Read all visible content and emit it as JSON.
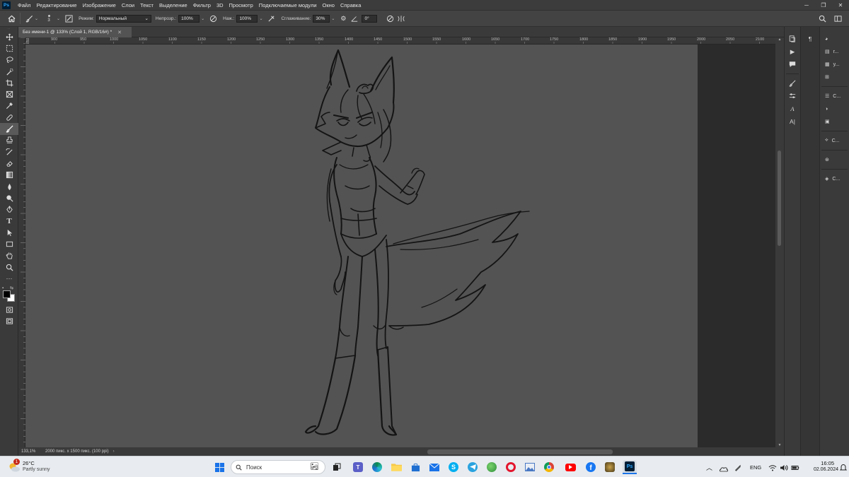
{
  "app": {
    "logo": "Ps",
    "menu": [
      "Файл",
      "Редактирование",
      "Изображение",
      "Слои",
      "Текст",
      "Выделение",
      "Фильтр",
      "3D",
      "Просмотр",
      "Подключаемые модули",
      "Окно",
      "Справка"
    ]
  },
  "options": {
    "brush_size": "3",
    "mode_label": "Режим:",
    "mode_value": "Нормальный",
    "opacity_label": "Непрозр.:",
    "opacity_value": "100%",
    "flow_label": "Наж.:",
    "flow_value": "100%",
    "smoothing_label": "Сглаживание:",
    "smoothing_value": "30%",
    "angle_value": "0°"
  },
  "document": {
    "tab_title": "Без имени-1 @ 133% (Слой 1, RGB/16#) *",
    "ruler_ticks": [
      "850",
      "900",
      "950",
      "1000",
      "1050",
      "1100",
      "1150",
      "1200",
      "1250",
      "1300",
      "1350",
      "1400",
      "1450",
      "1500",
      "1550",
      "1600",
      "1650",
      "1700",
      "1750",
      "1800",
      "1850",
      "1900",
      "1950",
      "2000",
      "2050",
      "2100"
    ]
  },
  "status": {
    "zoom": "133,1%",
    "doc_info": "2000 пикс. x 1500 пикс. (100 ppi)"
  },
  "panels": {
    "col3": [
      {
        "icon": "color-icon",
        "label": ""
      },
      {
        "icon": "properties-icon",
        "label": "г..."
      },
      {
        "icon": "swatches-icon",
        "label": "у..."
      },
      {
        "icon": "grid-icon",
        "label": ""
      },
      {
        "icon": "adjustments-icon",
        "label": "С..."
      },
      {
        "icon": "circle-half-icon",
        "label": ""
      },
      {
        "icon": "libraries-icon",
        "label": ""
      },
      {
        "icon": "paths-icon",
        "label": "С..."
      },
      {
        "icon": "channels-icon",
        "label": ""
      },
      {
        "icon": "layers-icon",
        "label": "С..."
      }
    ]
  },
  "taskbar": {
    "weather_temp": "26°C",
    "weather_desc": "Partly sunny",
    "weather_badge": "1",
    "search_placeholder": "Поиск",
    "lang": "ENG",
    "time": "16:05",
    "date": "02.06.2024"
  },
  "colors": {
    "accent_ps": "#31a8ff",
    "canvas": "#535353",
    "pasteboard": "#2b2b2b"
  }
}
